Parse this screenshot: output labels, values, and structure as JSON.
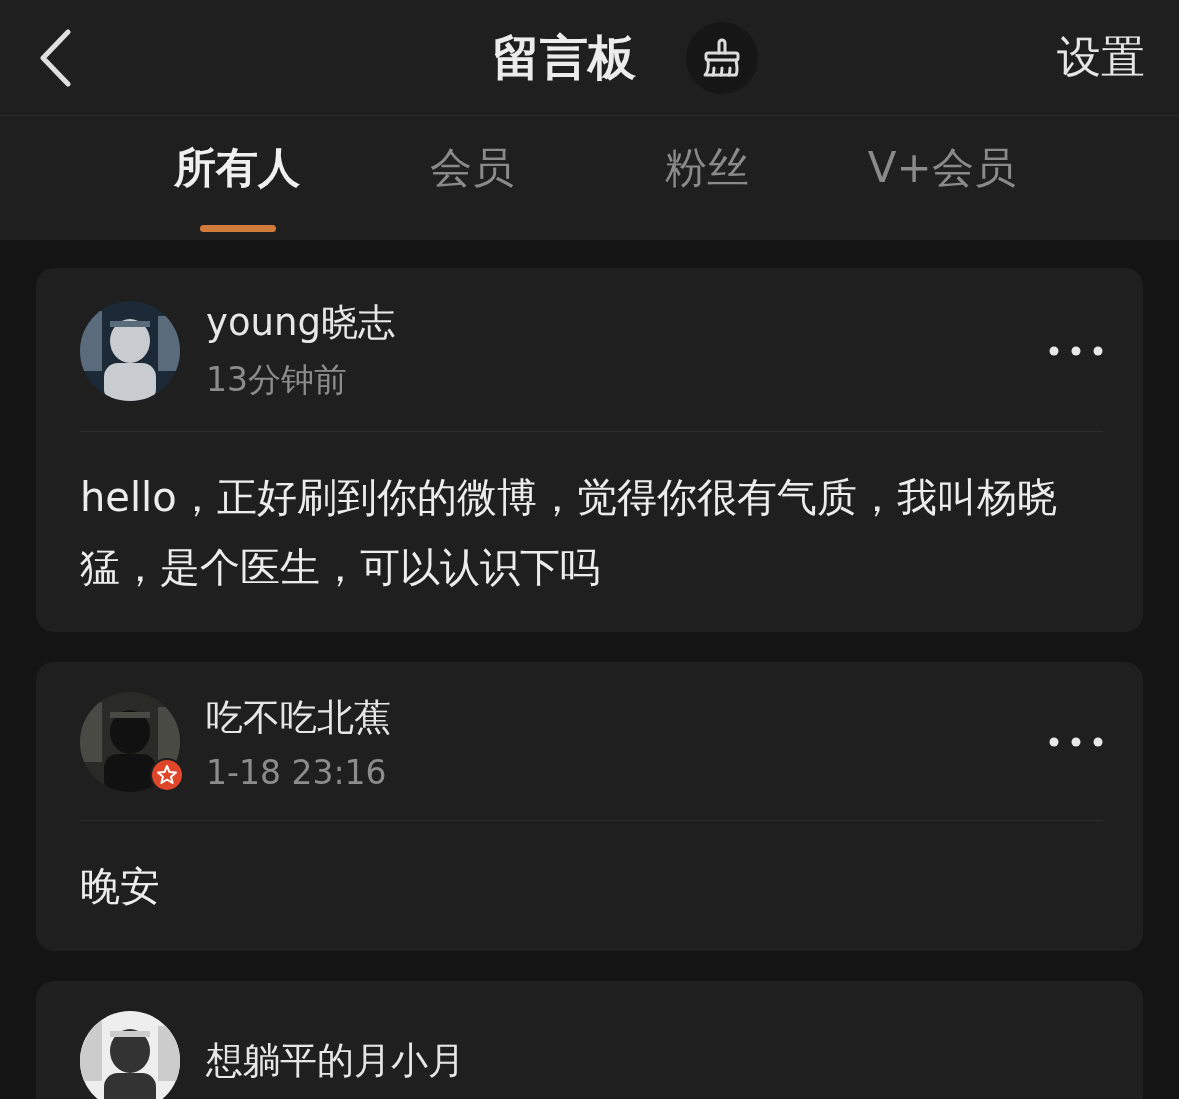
{
  "header": {
    "title": "留言板",
    "action": "设置"
  },
  "tabs": [
    {
      "label": "所有人",
      "selected": true
    },
    {
      "label": "会员",
      "selected": false
    },
    {
      "label": "粉丝",
      "selected": false
    },
    {
      "label": "V+会员",
      "selected": false
    }
  ],
  "posts": [
    {
      "author": "young晓志",
      "time": "13分钟前",
      "badge": false,
      "message": "hello，正好刷到你的微博，觉得你很有气质，我叫杨晓猛，是个医生，可以认识下吗"
    },
    {
      "author": "吃不吃北蕉",
      "time": "1-18 23:16",
      "badge": true,
      "message": "晚安"
    },
    {
      "author": "想躺平的月小月"
    }
  ]
}
